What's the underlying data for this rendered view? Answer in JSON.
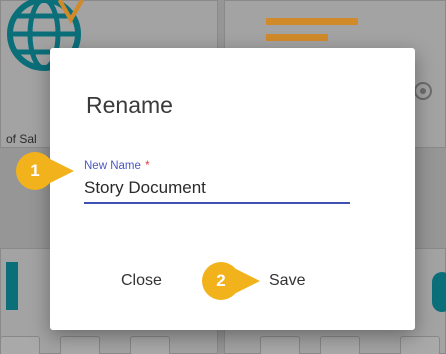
{
  "background": {
    "partial_text": "of Sal"
  },
  "dialog": {
    "title": "Rename",
    "field": {
      "label": "New Name",
      "required_marker": "*",
      "value": "Story Document"
    },
    "buttons": {
      "close_label": "Close",
      "save_label": "Save"
    }
  },
  "callouts": [
    {
      "number": "1",
      "target": "new-name-field"
    },
    {
      "number": "2",
      "target": "save-button"
    }
  ],
  "colors": {
    "accent": "#3f51b5",
    "label": "#4a58c0",
    "required": "#e53935",
    "callout": "#f2b21b",
    "overlay_bg": "#969696"
  }
}
